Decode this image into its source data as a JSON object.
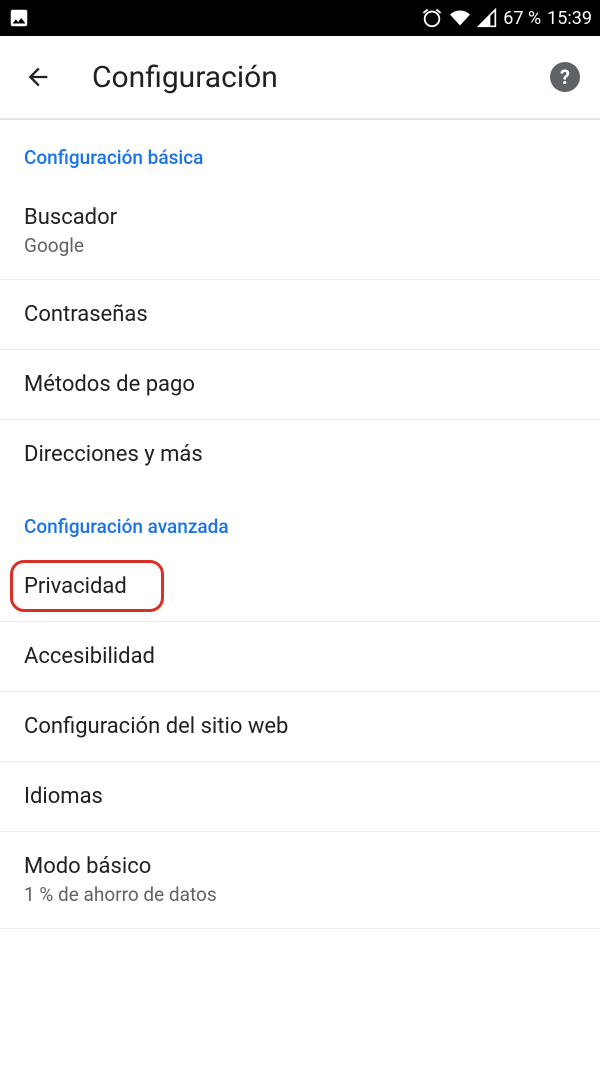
{
  "status_bar": {
    "battery_percent": "67 %",
    "time": "15:39"
  },
  "app_bar": {
    "title": "Configuración",
    "help_label": "?"
  },
  "sections": {
    "basic": {
      "header": "Configuración básica",
      "items": [
        {
          "title": "Buscador",
          "subtitle": "Google"
        },
        {
          "title": "Contraseñas"
        },
        {
          "title": "Métodos de pago"
        },
        {
          "title": "Direcciones y más"
        }
      ]
    },
    "advanced": {
      "header": "Configuración avanzada",
      "items": [
        {
          "title": "Privacidad",
          "highlighted": true
        },
        {
          "title": "Accesibilidad"
        },
        {
          "title": "Configuración del sitio web"
        },
        {
          "title": "Idiomas"
        },
        {
          "title": "Modo básico",
          "subtitle": "1 % de ahorro de datos"
        }
      ]
    }
  }
}
